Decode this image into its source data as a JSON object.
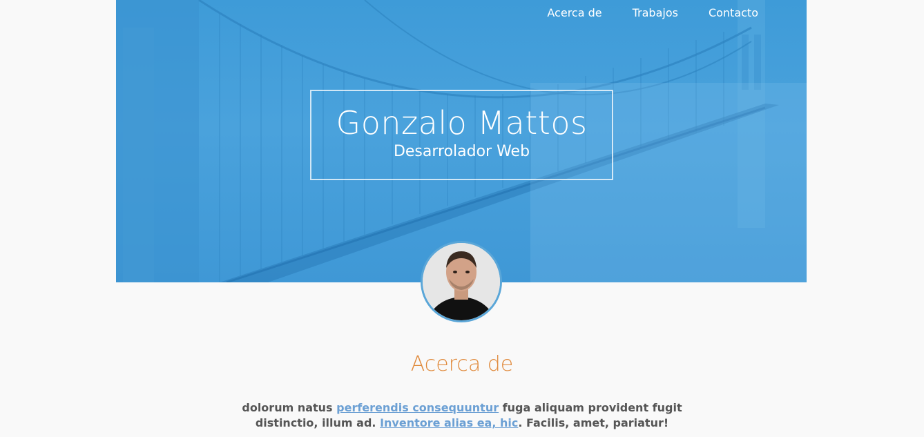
{
  "nav": {
    "items": [
      {
        "label": "Acerca de"
      },
      {
        "label": "Trabajos"
      },
      {
        "label": "Contacto"
      }
    ]
  },
  "hero": {
    "name": "Gonzalo Mattos",
    "role": "Desarrolador Web"
  },
  "about": {
    "title": "Acerca de",
    "text_1": "dolorum natus ",
    "link_1": "perferendis consequuntur",
    "text_2": " fuga aliquam provident fugit distinctio, illum ad. ",
    "link_2": "Inventore alias ea, hic",
    "text_3": ". Facilis, amet, pariatur!"
  },
  "colors": {
    "hero_blue": "#3e9bd8",
    "accent_orange": "#e08a3c",
    "link_blue": "#6ca0d4",
    "body_text": "#555555"
  }
}
